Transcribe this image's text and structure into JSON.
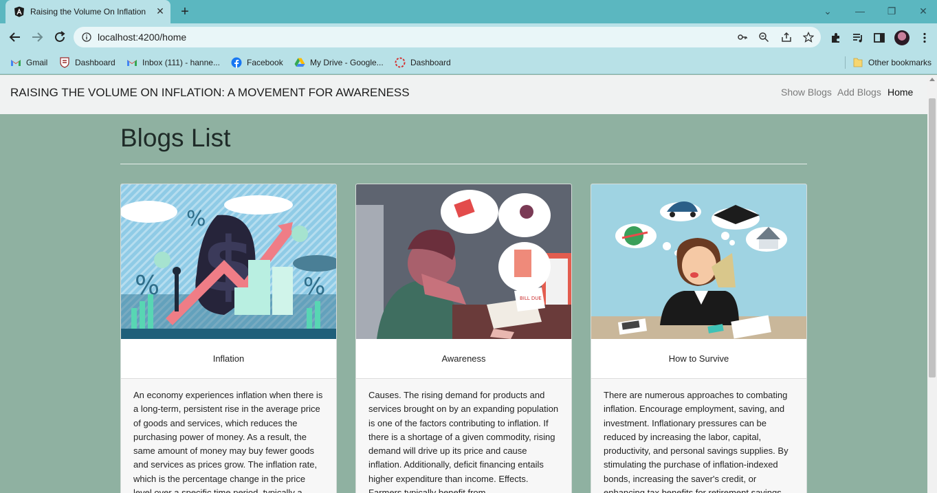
{
  "browser": {
    "tab_title": "Raising the Volume On Inflation",
    "url": "localhost:4200/home",
    "bookmarks": [
      {
        "label": "Gmail",
        "icon": "gmail-icon"
      },
      {
        "label": "Dashboard",
        "icon": "crest-icon"
      },
      {
        "label": "Inbox (111) - hanne...",
        "icon": "gmail-icon"
      },
      {
        "label": "Facebook",
        "icon": "facebook-icon"
      },
      {
        "label": "My Drive - Google...",
        "icon": "google-drive-icon"
      },
      {
        "label": "Dashboard",
        "icon": "dashed-circle-icon"
      }
    ],
    "other_bookmarks": "Other bookmarks"
  },
  "navbar": {
    "brand": "RAISING THE VOLUME ON INFLATION: A MOVEMENT FOR AWARENESS",
    "links": [
      "Show Blogs",
      "Add Blogs",
      "Home"
    ]
  },
  "page": {
    "title": "Blogs List"
  },
  "cards": [
    {
      "title": "Inflation",
      "body": "An economy experiences inflation when there is a long-term, persistent rise in the average price of goods and services, which reduces the purchasing power of money. As a result, the same amount of money may buy fewer goods and services as prices grow. The inflation rate, which is the percentage change in the price level over a specific time period, typically a",
      "image": "inflation-illustration"
    },
    {
      "title": "Awareness",
      "body": "Causes. The rising demand for products and services brought on by an expanding population is one of the factors contributing to inflation. If there is a shortage of a given commodity, rising demand will drive up its price and cause inflation. Additionally, deficit financing entails higher expenditure than income. Effects. Farmers typically benefit from",
      "image": "stressed-person-illustration"
    },
    {
      "title": "How to Survive",
      "body": "There are numerous approaches to combating inflation. Encourage employment, saving, and investment. Inflationary pressures can be reduced by increasing the labor, capital, productivity, and personal savings supplies. By stimulating the purchase of inflation-indexed bonds, increasing the saver's credit, or enhancing tax benefits for retirement savings,",
      "image": "thinking-woman-illustration"
    }
  ],
  "colors": {
    "page_background": "#8fb1a1",
    "browser_frame": "#5bb7c0",
    "toolbar": "#b8e1e7"
  }
}
